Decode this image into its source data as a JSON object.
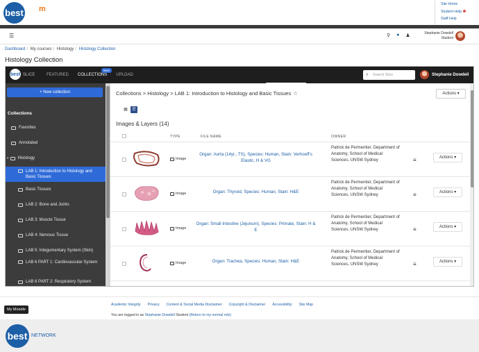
{
  "site": {
    "logo_text": "best",
    "links": [
      "Site Home",
      "Student Help",
      "Staff Help"
    ]
  },
  "navbar": {
    "user_name": "Stephanie Dowdell",
    "user_role": "Student"
  },
  "breadcrumb": [
    "Dashboard",
    "My courses",
    "Histology",
    "Histology Collection"
  ],
  "page_title": "Histology Collection",
  "slice": {
    "logo_text": "best",
    "brand": "SLICE",
    "tabs": [
      "FEATURED",
      "COLLECTIONS",
      "UPLOAD"
    ],
    "active_tab": "COLLECTIONS",
    "new_badge": "New",
    "search_placeholder": "Search Slice",
    "user_name": "Stephanie Dowdell"
  },
  "sidebar": {
    "new_collection_label": "+ New collection",
    "heading": "Collections",
    "items": [
      {
        "label": "Favorites",
        "level": 0
      },
      {
        "label": "Annotated",
        "level": 0
      },
      {
        "label": "Histology",
        "level": 0,
        "expanded": true
      },
      {
        "label": "LAB 1: Introduction to Histology and Basic Tissues",
        "level": 1,
        "active": true
      },
      {
        "label": "Basic Tissues",
        "level": 1
      },
      {
        "label": "LAB 2: Bone and Joints",
        "level": 1
      },
      {
        "label": "LAB 3: Muscle Tissue",
        "level": 1
      },
      {
        "label": "LAB 4: Nervous Tissue",
        "level": 1
      },
      {
        "label": "LAB 5: Integumentary System (Skin)",
        "level": 1
      },
      {
        "label": "LAB 6 PART 1: Cardiovascular System",
        "level": 1
      },
      {
        "label": "LAB 6 PART 2: Respiratory System",
        "level": 1
      }
    ]
  },
  "main": {
    "crumbs": "Collections > Histology > LAB 1: Introduction to Histology and Basic Tissues",
    "actions_label": "Actions",
    "section_heading": "Images & Layers (14)",
    "columns": {
      "type": "TYPE",
      "file_name": "FILE NAME",
      "owner": "OWNER"
    },
    "rows": [
      {
        "type": "Image",
        "file_name": "Organ: Aorta (14yr., TS), Species: Human, Stain: Verhoeff's Elastic, H & VG",
        "owner": "Patrick de Permentier, Department of Anatomy, School of Medical Sciences, UNSW Sydney",
        "actions": "Actions"
      },
      {
        "type": "Image",
        "file_name": "Organ: Thyroid, Species: Human, Stain: H&E",
        "owner": "Patrick de Permentier, Department of Anatomy, School of Medical Sciences, UNSW Sydney",
        "actions": "Actions"
      },
      {
        "type": "Image",
        "file_name": "Organ: Small Intestine (Jejunum), Species: Primate, Stain: H & E",
        "owner": "Patrick de Permentier, Department of Anatomy, School of Medical Sciences, UNSW Sydney",
        "actions": "Actions"
      },
      {
        "type": "Image",
        "file_name": "Organ: Trachea, Species: Human, Stain: H&E",
        "owner": "Patrick de Permentier, Department of Anatomy, School of Medical Sciences, UNSW Sydney",
        "actions": "Actions"
      }
    ]
  },
  "footer": {
    "my_moodle": "My Moodle",
    "links": [
      "Academic Integrity",
      "Privacy",
      "Content & Social Media Disclaimer",
      "Copyright & Disclaimer",
      "Accessibility",
      "Site Map"
    ],
    "login_prefix": "You are logged in as",
    "login_user": "Stephanie Dowdell",
    "login_role": "Student",
    "return_link": "(Return to my normal role)",
    "network": "NETWORK"
  }
}
